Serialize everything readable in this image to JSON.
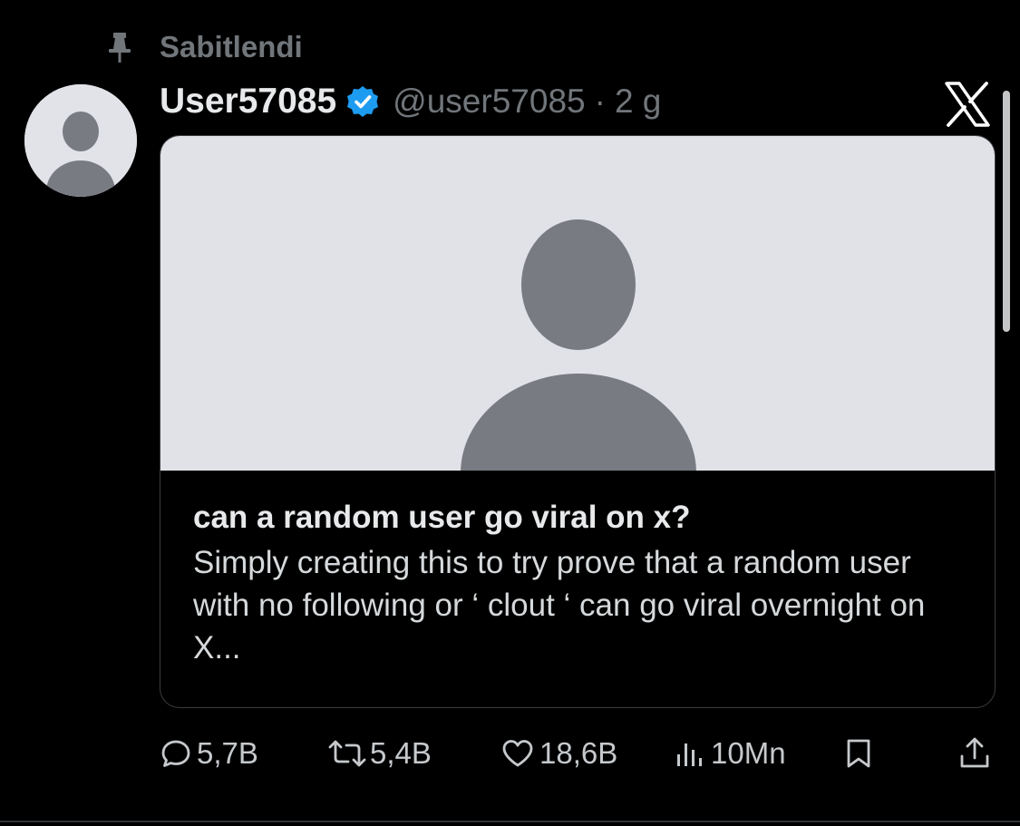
{
  "pinned": {
    "label": "Sabitlendi",
    "icon": "pin-icon"
  },
  "author": {
    "display_name": "User57085",
    "handle": "@user57085",
    "separator": "·",
    "age": "2 g",
    "verified": true,
    "verified_color": "#1d9bf0"
  },
  "card": {
    "title": "can a random user go viral on x?",
    "description": "Simply creating this to try prove that a random user with no following or ‘ clout ‘ can go viral overnight on X..."
  },
  "actions": {
    "replies": "5,7B",
    "reposts": "5,4B",
    "likes": "18,6B",
    "views": "10Mn"
  },
  "colors": {
    "background": "#000000",
    "text_primary": "#e7e9ea",
    "text_secondary": "#71767b",
    "placeholder_bg": "#e1e2e7",
    "placeholder_figure": "#787b82"
  }
}
